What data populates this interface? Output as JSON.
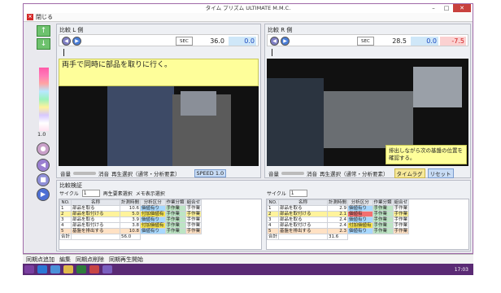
{
  "window": {
    "title": "タイム プリズム ULTIMATE M.M.C.",
    "close_label": "閉じる"
  },
  "left_panel": {
    "title": "比較 L 側",
    "sec": "SEC",
    "time": "36.0",
    "diff": "0.0",
    "caption": "両手で同時に部品を取りに行く。",
    "volume": "音量",
    "mute": "消音",
    "play_select": "再生選択（通常・分析要素）",
    "speed": "SPEED 1.0"
  },
  "right_panel": {
    "title": "比較 R 側",
    "sec": "SEC",
    "time": "28.5",
    "diff": "0.0",
    "diff2": "-7.5",
    "caption": "排出しながら次の基盤の位置を確認する。",
    "volume": "音量",
    "mute": "消音",
    "play_select": "再生選択（通常・分析要素）",
    "timelag": "タイムラグ",
    "reset": "リセット"
  },
  "side": {
    "palette_value": "1.0"
  },
  "compare": {
    "title": "比較検証",
    "cycle_label": "サイクル",
    "cycle_value": "1",
    "left_tabs": [
      "再生要素選択",
      "メモ表示選択"
    ],
    "headers": [
      "NO.",
      "名称",
      "計測時間",
      "分析区分",
      "作業分類",
      "組合せ"
    ],
    "left_rows": [
      [
        "1",
        "部品を取る",
        "10.6",
        "価値有り",
        "手作業",
        "手作業"
      ],
      [
        "2",
        "部品を取付ける",
        "5.0",
        "付加価値有",
        "手作業",
        "手作業"
      ],
      [
        "3",
        "部品を取る",
        "3.9",
        "価値有り",
        "手作業",
        "手作業"
      ],
      [
        "4",
        "部品を取付ける",
        "3.8",
        "付加価値有",
        "手作業",
        "手作業"
      ],
      [
        "5",
        "基盤を排出する",
        "10.8",
        "価値有り",
        "手作業",
        "手作業"
      ]
    ],
    "left_total": [
      "合計",
      "",
      "56.0"
    ],
    "right_rows": [
      [
        "1",
        "部品を取る",
        "2.9",
        "価値有り",
        "手作業",
        "手作業"
      ],
      [
        "2",
        "部品を取付ける",
        "2.1",
        "価値有",
        "手作業",
        "手作業"
      ],
      [
        "3",
        "部品を取る",
        "2.4",
        "価値有り",
        "手作業",
        "手作業"
      ],
      [
        "4",
        "部品を取付ける",
        "2.4",
        "付加価値有",
        "手作業",
        "手作業"
      ],
      [
        "5",
        "基盤を排出する",
        "2.3",
        "価値有り",
        "手作業",
        "手作業"
      ]
    ],
    "right_total": [
      "合計",
      "",
      "31.6"
    ]
  },
  "bottom_bar": {
    "items": [
      "同期点追加",
      "編集",
      "同期点削除",
      "同期再生開始"
    ]
  },
  "taskbar": {
    "time": "17:03"
  }
}
